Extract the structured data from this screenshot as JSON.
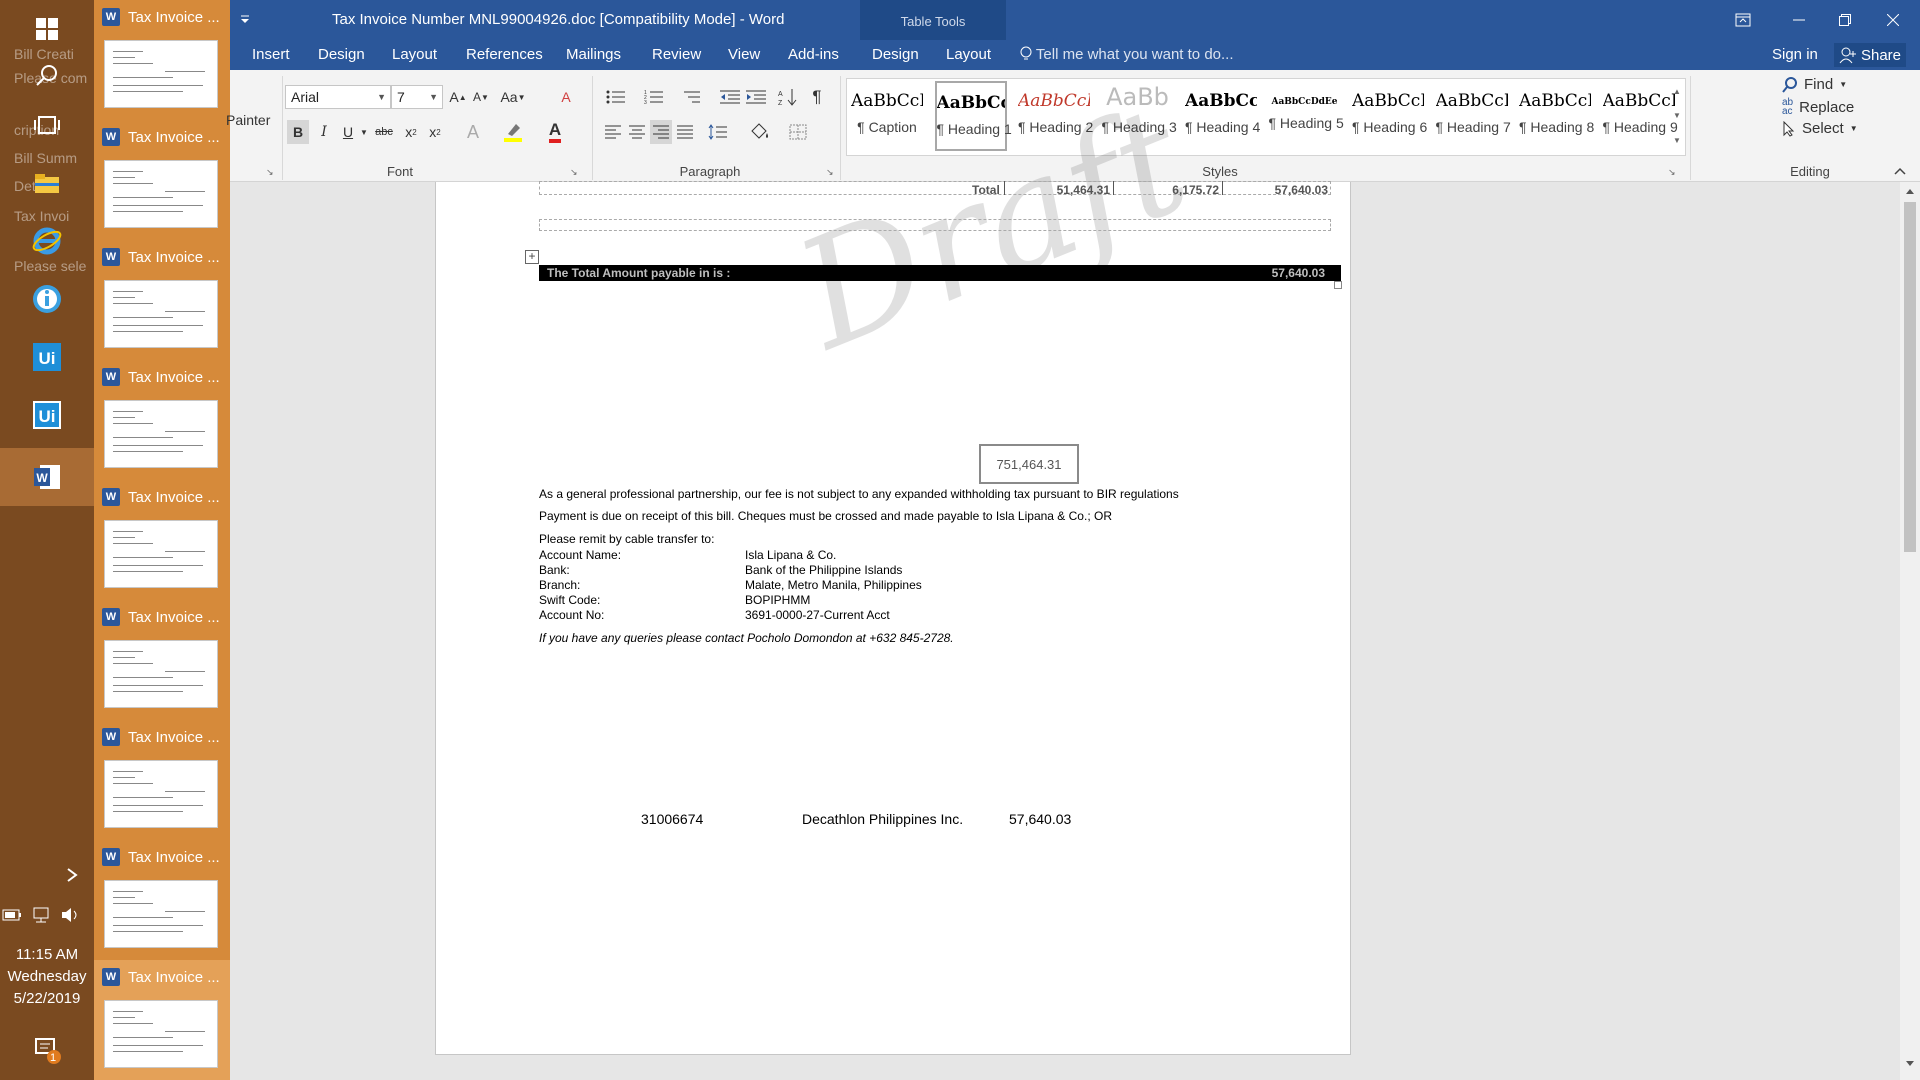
{
  "taskbar": {
    "clock_time": "11:15 AM",
    "clock_day": "Wednesday",
    "clock_date": "5/22/2019",
    "notification_count": "1",
    "ghost_texts": [
      "Bill Creati",
      "Please com",
      "cription",
      "Bill Summ",
      "Details",
      "Tax Invoi",
      "Please sele"
    ]
  },
  "thumbnails": [
    {
      "label": "Tax Invoice ..."
    },
    {
      "label": "Tax Invoice ..."
    },
    {
      "label": "Tax Invoice ..."
    },
    {
      "label": "Tax Invoice ..."
    },
    {
      "label": "Tax Invoice ..."
    },
    {
      "label": "Tax Invoice ..."
    },
    {
      "label": "Tax Invoice ..."
    },
    {
      "label": "Tax Invoice ..."
    },
    {
      "label": "Tax Invoice ..."
    }
  ],
  "window": {
    "title": "Tax Invoice Number MNL99004926.doc [Compatibility Mode] - Word",
    "context_title": "Table Tools"
  },
  "tabs": [
    "Insert",
    "Design",
    "Layout",
    "References",
    "Mailings",
    "Review",
    "View",
    "Add-ins",
    "Design",
    "Layout"
  ],
  "tell_me": "Tell me what you want to do...",
  "sign_in": "Sign in",
  "share": "Share",
  "ribbon": {
    "clipboard_fragment": "Painter",
    "font_name": "Arial",
    "font_size": "7",
    "groups": {
      "font": "Font",
      "paragraph": "Paragraph",
      "styles": "Styles",
      "editing": "Editing"
    },
    "styles": [
      {
        "sample": "AaBbCcI",
        "name": "¶ Caption"
      },
      {
        "sample": "AaBbCcD",
        "name": "¶ Heading 1"
      },
      {
        "sample": "AaBbCcDa",
        "name": "¶ Heading 2"
      },
      {
        "sample": "AaBb",
        "name": "¶ Heading 3"
      },
      {
        "sample": "AaBbCcD",
        "name": "¶ Heading 4"
      },
      {
        "sample": "AaBbCcDdEe",
        "name": "¶ Heading 5"
      },
      {
        "sample": "AaBbCcI",
        "name": "¶ Heading 6"
      },
      {
        "sample": "AaBbCcI",
        "name": "¶ Heading 7"
      },
      {
        "sample": "AaBbCcI",
        "name": "¶ Heading 8"
      },
      {
        "sample": "AaBbCcI",
        "name": "¶ Heading 9"
      }
    ],
    "editing": {
      "find": "Find",
      "replace": "Replace",
      "select": "Select"
    }
  },
  "document": {
    "total_label": "Total",
    "total_values": [
      "51,464.31",
      "6,175.72",
      "57,640.03"
    ],
    "payable_label": "The Total Amount payable in  is :",
    "payable_value": "57,640.03",
    "watermark": "Draft",
    "boxed_value": "751,464.31",
    "line1": "As a general professional partnership, our fee is not subject to any expanded withholding tax pursuant to BIR regulations",
    "line2": "Payment is due on receipt of this bill. Cheques must be crossed and made payable to  Isla Lipana & Co.; OR",
    "remit": "Please remit by cable transfer to:",
    "bank_details": [
      {
        "label": "Account Name:",
        "value": "Isla Lipana & Co."
      },
      {
        "label": "Bank:",
        "value": "Bank of the Philippine Islands"
      },
      {
        "label": "Branch:",
        "value": "Malate, Metro Manila, Philippines"
      },
      {
        "label": "Swift Code:",
        "value": "BOPIPHMM"
      },
      {
        "label": "Account No:",
        "value": "3691-0000-27-Current Acct"
      }
    ],
    "queries": "If you have any queries please contact Pocholo Domondon at +632 845-2728.",
    "footer_row": [
      "31006674",
      "Decathlon Philippines Inc.",
      "57,640.03"
    ]
  },
  "colors": {
    "word_blue": "#2b579a",
    "taskbar": "#7a4a20",
    "thumb_strip": "#d68a3a"
  }
}
